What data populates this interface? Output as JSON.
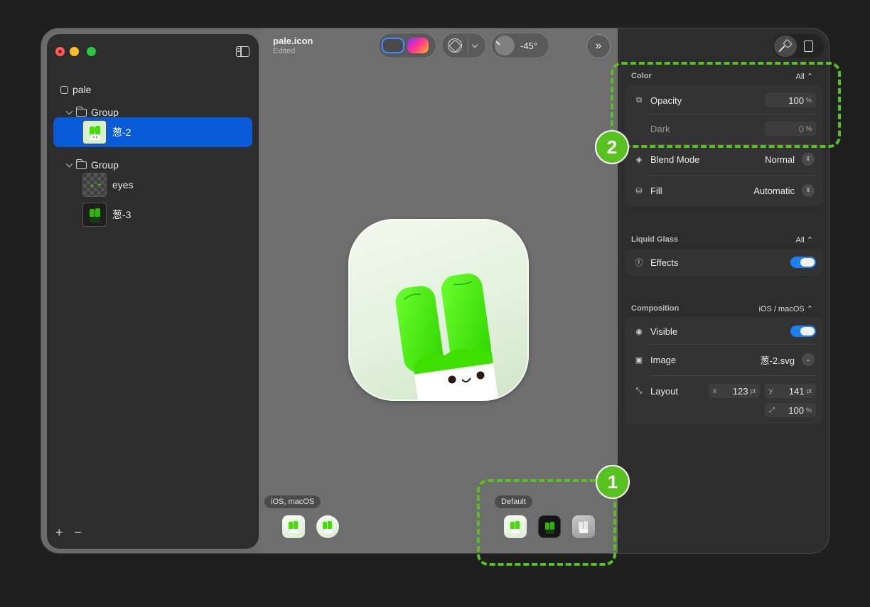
{
  "document": {
    "title": "pale.icon",
    "subtitle": "Edited"
  },
  "toolbar": {
    "light_angle": "-45°"
  },
  "sidebar": {
    "root": "pale",
    "group1": "Group",
    "layer1": "葱-2",
    "group2": "Group",
    "layer2": "eyes",
    "layer3": "葱-3",
    "add_label": "+",
    "remove_label": "−"
  },
  "canvas": {
    "variant_group1_label": "iOS, macOS",
    "variant_group2_label": "Default"
  },
  "inspector": {
    "color": {
      "header": "Color",
      "scope": "All ⌃",
      "opacity_label": "Opacity",
      "opacity_value": "100",
      "dark_label": "Dark",
      "dark_value": "0",
      "percent": "%",
      "blend_label": "Blend Mode",
      "blend_value": "Normal",
      "fill_label": "Fill",
      "fill_value": "Automatic"
    },
    "liquid_glass": {
      "header": "Liquid Glass",
      "scope": "All ⌃",
      "effects_label": "Effects",
      "effects_on": true
    },
    "composition": {
      "header": "Composition",
      "scope": "iOS / macOS ⌃",
      "visible_label": "Visible",
      "visible_on": true,
      "image_label": "Image",
      "image_value": "葱-2.svg",
      "layout_label": "Layout",
      "x_label": "x",
      "x_value": "123",
      "y_label": "y",
      "y_value": "141",
      "unit_pt": "pt",
      "scale_value": "100",
      "percent": "%"
    }
  },
  "callouts": {
    "one": "1",
    "two": "2"
  },
  "colors": {
    "accent": "#0a5bd9",
    "callout": "#57c21f",
    "leek_green": "#3fe000"
  }
}
